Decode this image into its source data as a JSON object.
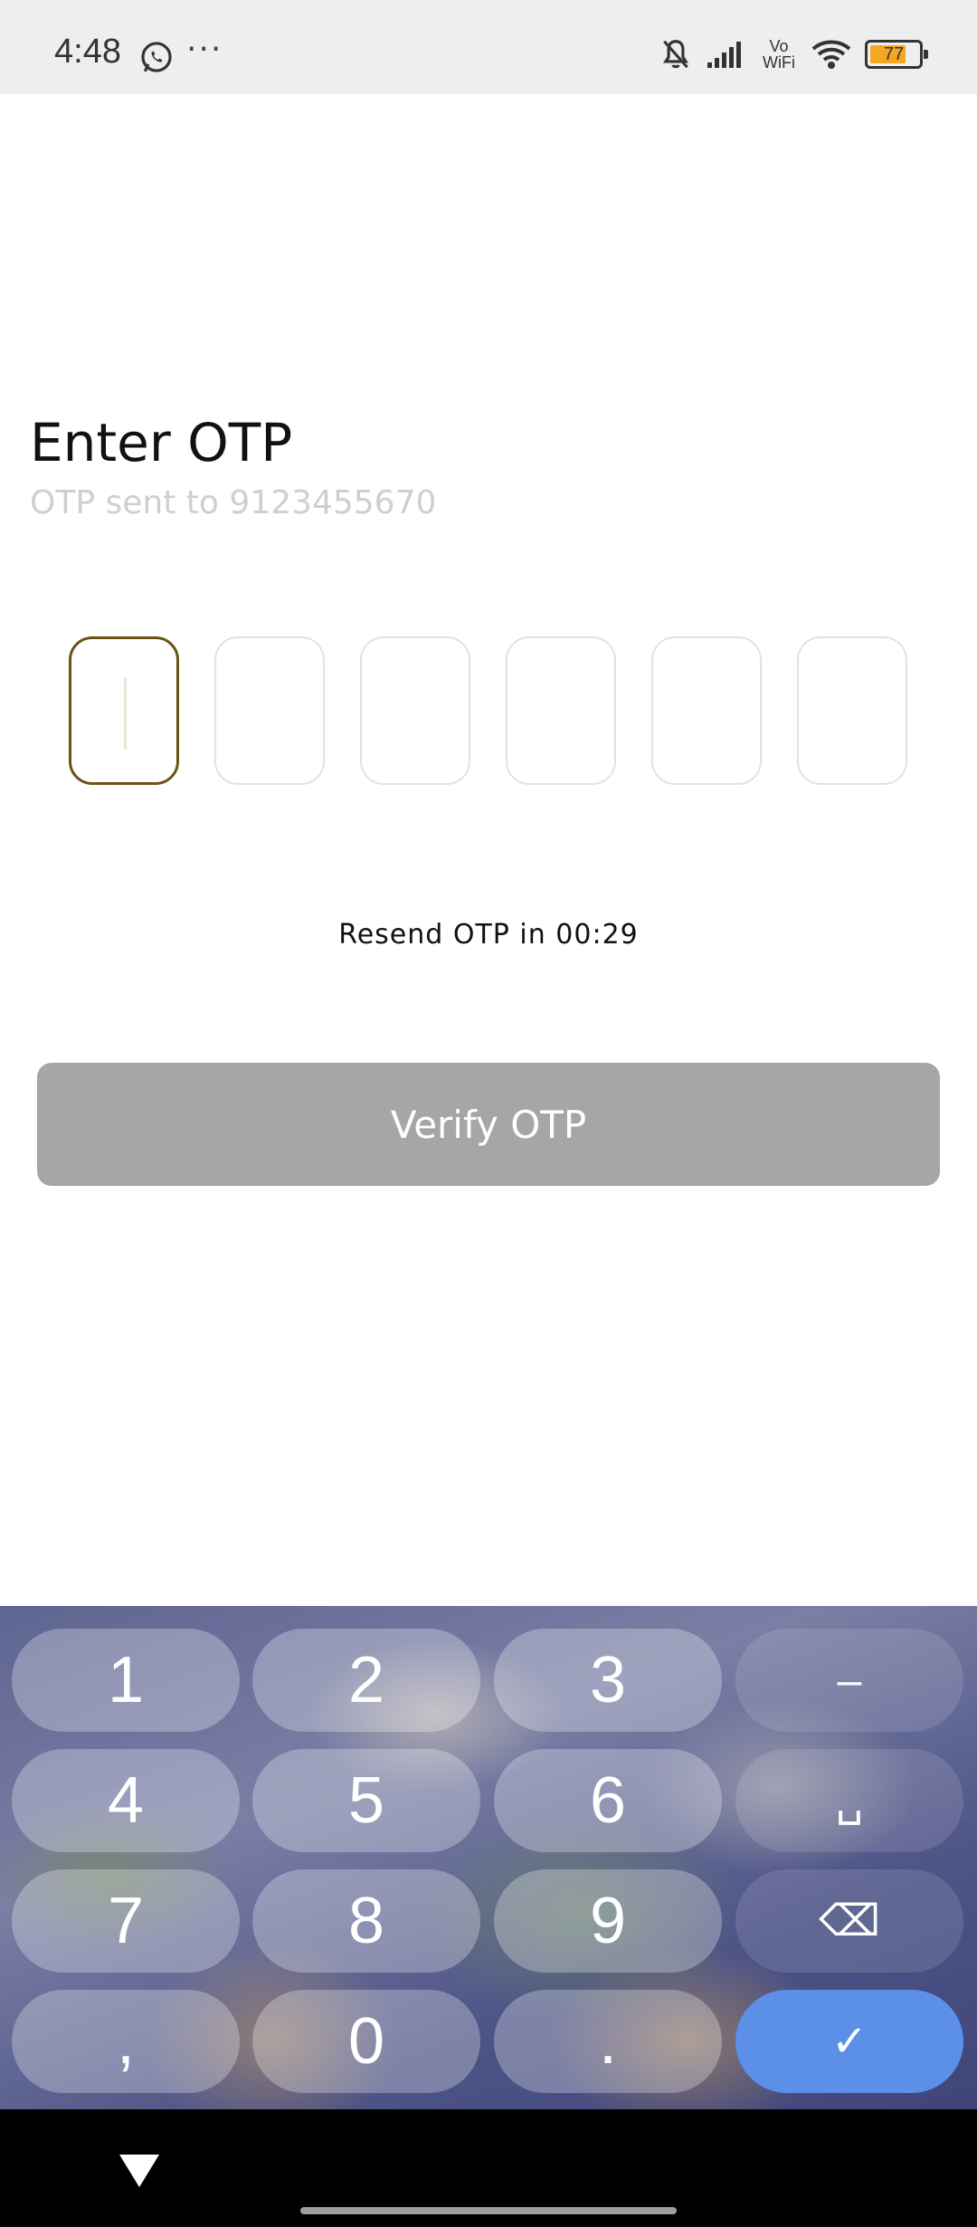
{
  "status_bar": {
    "time": "4:48",
    "icons": [
      "whatsapp-icon",
      "more-dots-icon",
      "mute-icon",
      "signal-icon",
      "vowifi-icon",
      "wifi-icon",
      "battery-icon"
    ],
    "more": "···",
    "vowifi_top": "Vo",
    "vowifi_bottom": "WiFi",
    "battery_level": "77",
    "battery_color": "#f5a623"
  },
  "header": {
    "title": "Enter OTP",
    "subtitle": "OTP sent to 9123455670"
  },
  "otp": {
    "digits": [
      "",
      "",
      "",
      "",
      "",
      ""
    ],
    "active_index": 0,
    "active_border_color": "#6b5318"
  },
  "resend": {
    "text": "Resend OTP in 00:29"
  },
  "verify_button": {
    "label": "Verify OTP",
    "color": "#a6a6a6"
  },
  "keyboard": {
    "keys": {
      "k1": "1",
      "k2": "2",
      "k3": "3",
      "dash": "–",
      "k4": "4",
      "k5": "5",
      "k6": "6",
      "space": "␣",
      "k7": "7",
      "k8": "8",
      "k9": "9",
      "backspace": "⌫",
      "comma": ",",
      "k0": "0",
      "period": ".",
      "enter": "✓"
    },
    "enter_color": "#5b8fe8"
  },
  "nav_bar": {
    "icons": [
      "back-triangle-icon",
      "home-pill-icon"
    ]
  }
}
